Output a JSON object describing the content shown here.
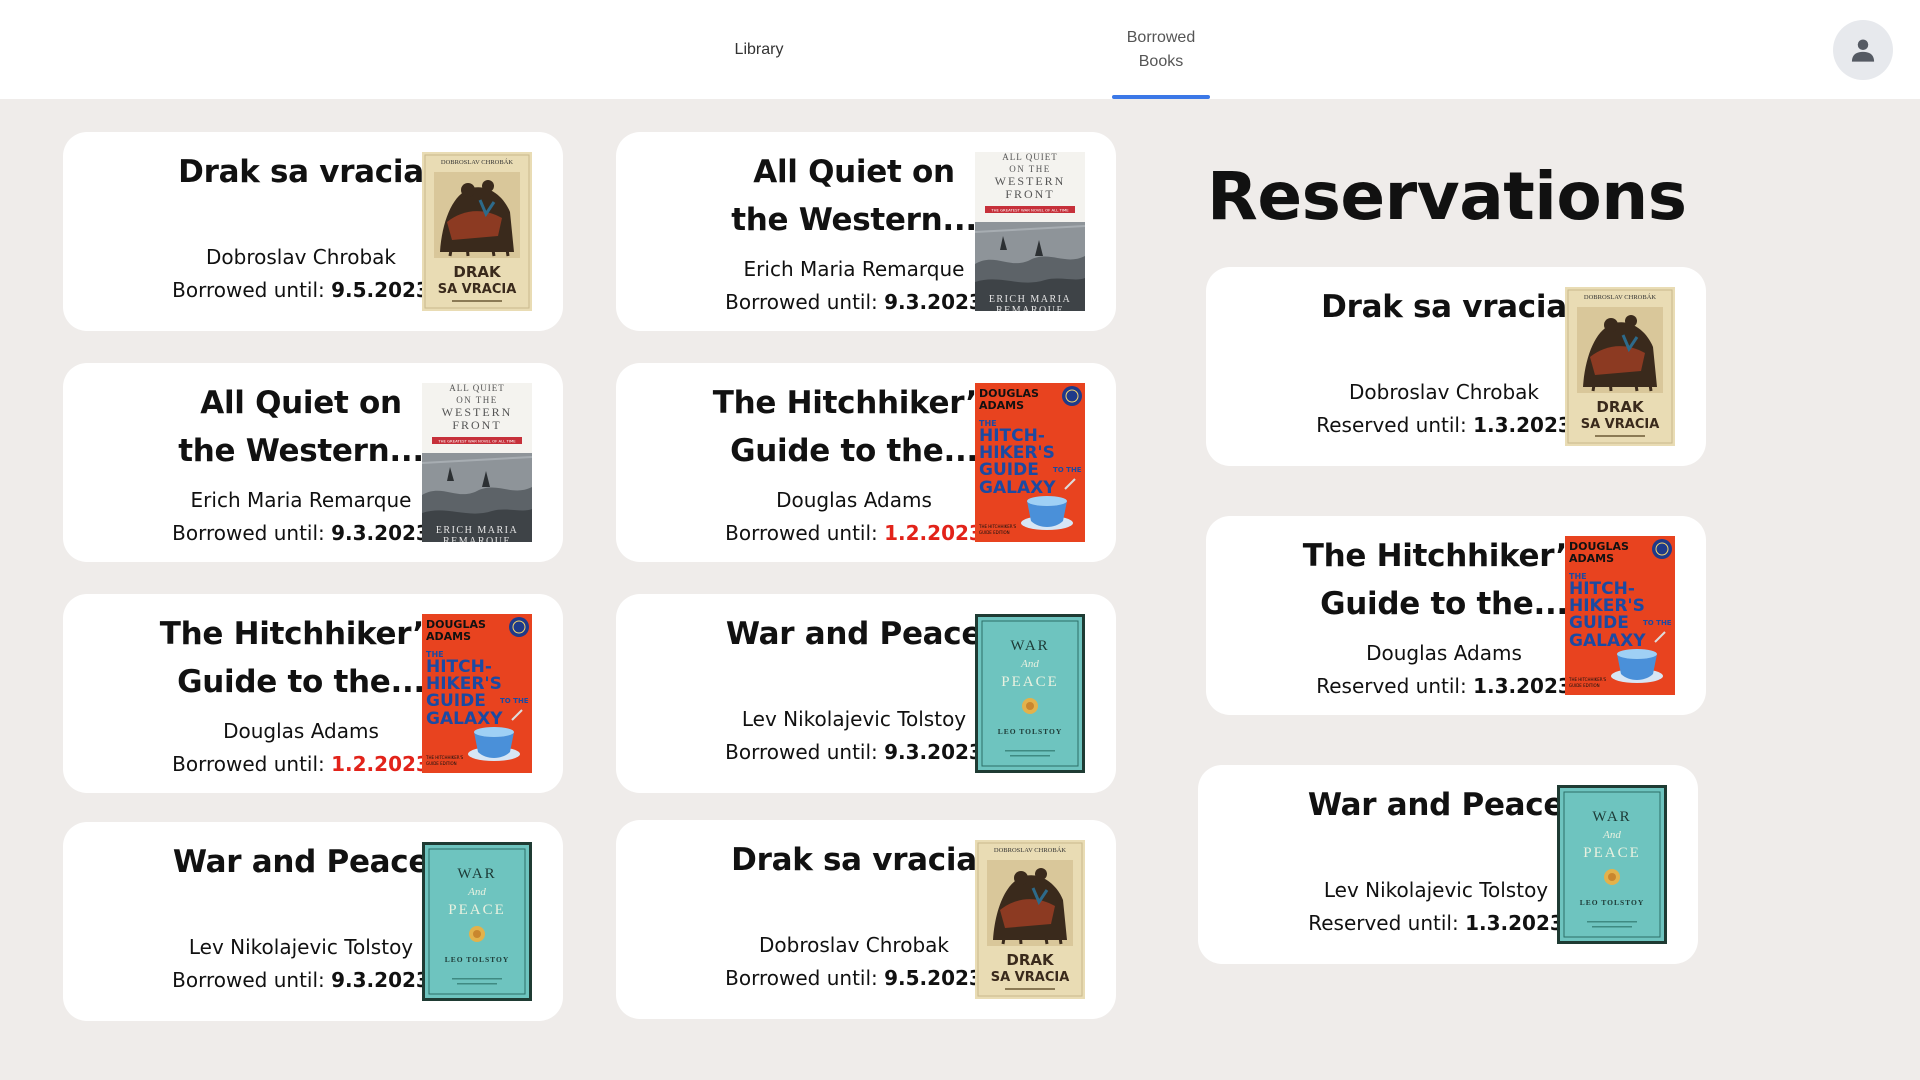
{
  "nav": {
    "tabs": [
      {
        "label": "Library"
      },
      {
        "label": "Borrowed\nBooks"
      }
    ]
  },
  "borrowed": [
    {
      "title": "Drak sa vracia",
      "author": "Dobroslav Chrobak",
      "due_label": "Borrowed until: ",
      "due_date": "9.5.2023",
      "cover": "drak",
      "overdue": false
    },
    {
      "title": "All Quiet on the Western...",
      "author": "Erich Maria Remarque",
      "due_label": "Borrowed until: ",
      "due_date": "9.3.2023",
      "cover": "quiet",
      "overdue": false
    },
    {
      "title": "All Quiet on the Western...",
      "author": "Erich Maria Remarque",
      "due_label": "Borrowed until: ",
      "due_date": "9.3.2023",
      "cover": "quiet",
      "overdue": false
    },
    {
      "title": "The Hitchhiker’s Guide to the...",
      "author": "Douglas Adams",
      "due_label": "Borrowed until: ",
      "due_date": "1.2.2023",
      "cover": "hitch",
      "overdue": true
    },
    {
      "title": "The Hitchhiker’s Guide to the...",
      "author": "Douglas Adams",
      "due_label": "Borrowed until: ",
      "due_date": "1.2.2023",
      "cover": "hitch",
      "overdue": true
    },
    {
      "title": "War and Peace",
      "author": "Lev Nikolajevic Tolstoy",
      "due_label": "Borrowed until: ",
      "due_date": "9.3.2023",
      "cover": "war",
      "overdue": false
    },
    {
      "title": "War and Peace",
      "author": "Lev Nikolajevic Tolstoy",
      "due_label": "Borrowed until: ",
      "due_date": "9.3.2023",
      "cover": "war",
      "overdue": false
    },
    {
      "title": "Drak sa vracia",
      "author": "Dobroslav Chrobak",
      "due_label": "Borrowed until: ",
      "due_date": "9.5.2023",
      "cover": "drak",
      "overdue": false
    }
  ],
  "reservations": {
    "heading": "Reservations",
    "items": [
      {
        "title": "Drak sa vracia",
        "author": "Dobroslav Chrobak",
        "due_label": "Reserved until: ",
        "due_date": "1.3.2023",
        "cover": "drak"
      },
      {
        "title": "The Hitchhiker’s Guide to the...",
        "author": "Douglas Adams",
        "due_label": "Reserved until: ",
        "due_date": "1.3.2023",
        "cover": "hitch"
      },
      {
        "title": "War and Peace",
        "author": "Lev Nikolajevic Tolstoy",
        "due_label": "Reserved until: ",
        "due_date": "1.3.2023",
        "cover": "war"
      }
    ]
  },
  "covers": {
    "drak": {
      "top": "DOBROSLAV CHROBÁK",
      "line1": "DRAK",
      "line2": "SA VRACIA"
    },
    "quiet": {
      "top": "ALL QUIET",
      "line1": "ON THE",
      "line2": "WESTERN",
      "line3": "FRONT",
      "band": "THE GREATEST WAR NOVEL OF ALL TIME",
      "bottom": "ERICH MARIA REMARQUE"
    },
    "hitch": {
      "top": "DOUGLAS ADAMS",
      "line1": "THE",
      "line2": "HITCH-",
      "line3": "HIKER'S",
      "line4": "GUIDE",
      "line5": "GALAXY",
      "to": "TO THE"
    },
    "war": {
      "line1": "WAR",
      "line2": "And",
      "line3": "PEACE",
      "author": "LEO TOLSTOY"
    }
  },
  "colors": {
    "accent": "#3b78e7",
    "overdue": "#e2231a",
    "background": "#efecea",
    "card": "#ffffff"
  }
}
